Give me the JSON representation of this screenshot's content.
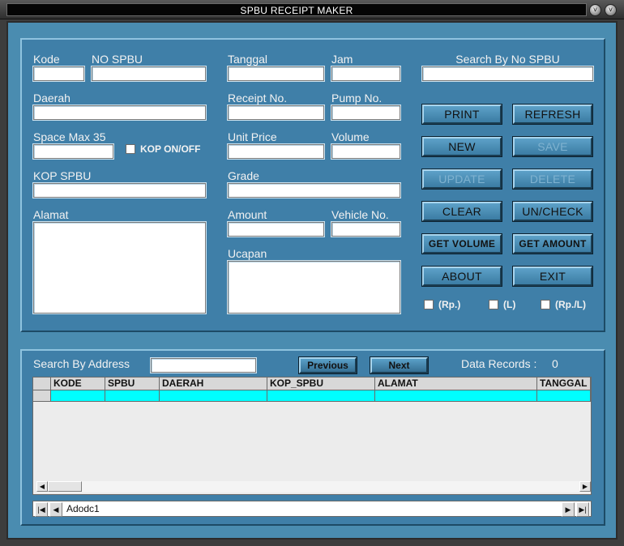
{
  "window": {
    "title": "SPBU RECEIPT MAKER",
    "minimize_glyph": "˅",
    "close_glyph": "˅"
  },
  "form": {
    "kode_label": "Kode",
    "no_spbu_label": "NO SPBU",
    "daerah_label": "Daerah",
    "space_max_label": "Space Max 35",
    "kop_toggle_label": "KOP ON/OFF",
    "kop_spbu_label": "KOP SPBU",
    "alamat_label": "Alamat",
    "tanggal_label": "Tanggal",
    "jam_label": "Jam",
    "receipt_no_label": "Receipt No.",
    "pump_no_label": "Pump No.",
    "unit_price_label": "Unit Price",
    "volume_label": "Volume",
    "grade_label": "Grade",
    "amount_label": "Amount",
    "vehicle_no_label": "Vehicle No.",
    "ucapan_label": "Ucapan",
    "search_no_spbu_label": "Search By No SPBU"
  },
  "buttons": {
    "print": "PRINT",
    "refresh": "REFRESH",
    "new": "NEW",
    "save": "SAVE",
    "update": "UPDATE",
    "delete": "DELETE",
    "clear": "CLEAR",
    "uncheck": "UN/CHECK",
    "get_volume": "GET VOLUME",
    "get_amount": "GET AMOUNT",
    "about": "ABOUT",
    "exit": "EXIT"
  },
  "checks": {
    "rp": "(Rp.)",
    "l": "(L)",
    "rp_l": "(Rp./L)"
  },
  "lower": {
    "search_address_label": "Search By Address",
    "previous": "Previous",
    "next": "Next",
    "records_label": "Data Records :",
    "records_count": "0"
  },
  "grid": {
    "columns": [
      "KODE",
      "SPBU",
      "DAERAH",
      "KOP_SPBU",
      "ALAMAT",
      "TANGGAL"
    ],
    "highlight_color": "#00ffff"
  },
  "adodc": {
    "caption": "Adodc1"
  },
  "colors": {
    "panel": "#3f7fa8",
    "frame": "#4a8cb0",
    "chrome": "#3d3d3d"
  }
}
